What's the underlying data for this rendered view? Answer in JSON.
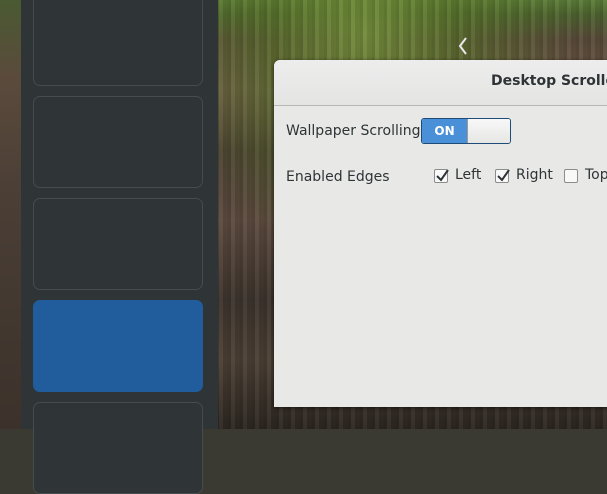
{
  "dialog": {
    "title": "Desktop Scroller",
    "wallpaper_scrolling_label": "Wallpaper Scrolling",
    "wallpaper_scrolling_switch": {
      "state_text": "ON",
      "on": true
    },
    "enabled_edges_label": "Enabled Edges",
    "edges": [
      {
        "label": "Left",
        "checked": true
      },
      {
        "label": "Right",
        "checked": true
      },
      {
        "label": "Top",
        "checked": false
      }
    ]
  },
  "workspace_switcher": {
    "workspaces": [
      {
        "active": false
      },
      {
        "active": false
      },
      {
        "active": false
      },
      {
        "active": true
      },
      {
        "active": false
      }
    ]
  },
  "colors": {
    "accent": "#4a90d9",
    "active_workspace": "#215d9c",
    "switcher_bg": "#2f3436"
  },
  "icons": [
    "chevron-left-icon",
    "checkmark-icon"
  ]
}
